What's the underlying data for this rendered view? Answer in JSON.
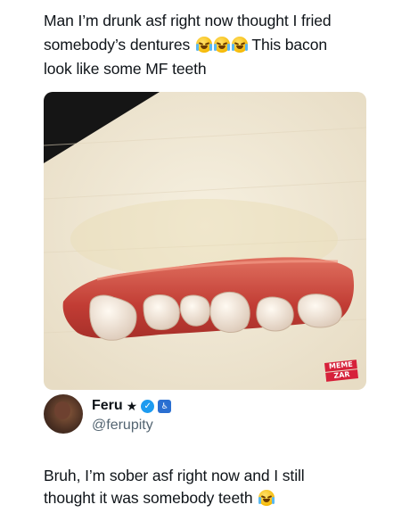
{
  "post": {
    "line1": "Man I’m drunk asf right now thought I fried",
    "line2_a": "somebody’s dentures",
    "line2_b": "This bacon",
    "line3": "look like some MF teeth",
    "emoji": "loudly-crying-face-icon"
  },
  "image": {
    "watermark_line1": "MEME",
    "watermark_line2": "ZAR",
    "colors": {
      "towel": "#f1ead8",
      "bacon": "#c8463d",
      "teeth": "#efe5dc",
      "counter": "#151515"
    }
  },
  "author": {
    "name": "Feru",
    "handle": "@ferupity",
    "star": "★",
    "verified_icon": "verified-badge-icon",
    "extra_badge_icon": "accessibility-badge-icon"
  },
  "reply": {
    "line1": "Bruh, I’m sober asf right now and I still",
    "line2": "thought it was somebody teeth"
  }
}
